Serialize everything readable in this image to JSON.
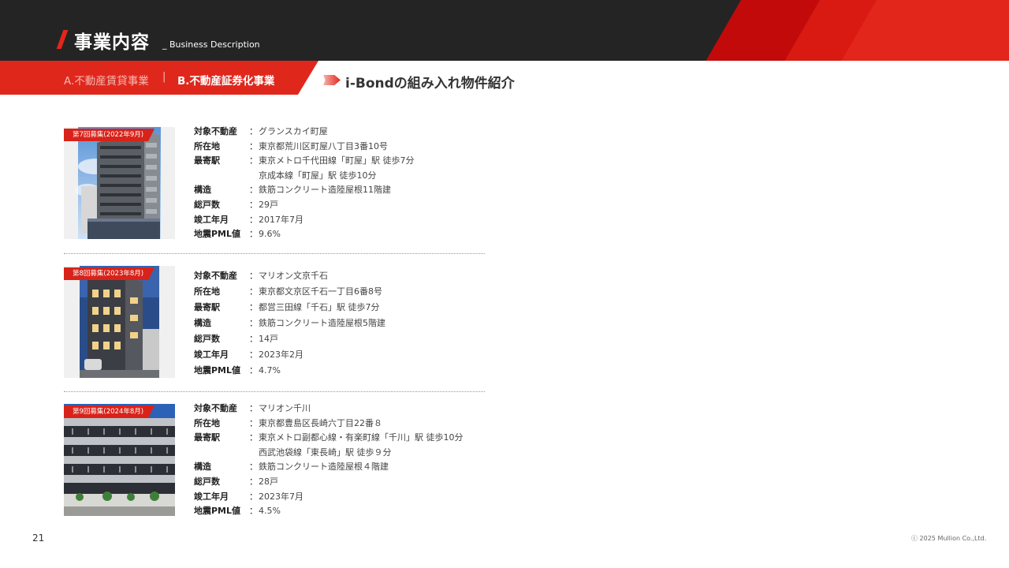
{
  "header": {
    "title": "事業内容",
    "subtitle": "_ Business Description"
  },
  "tabs": {
    "tab_a": "A.不動産賃貸事業",
    "separator": "|",
    "tab_b": "B.不動産証券化事業"
  },
  "section": {
    "title": "i-Bondの組み入れ物件紹介"
  },
  "colors": {
    "brand_red": "#e3261b",
    "header_dark": "#242424"
  },
  "properties": [
    {
      "badge": "第7回募集(2022年9月)",
      "rows": [
        {
          "label": "対象不動産",
          "value": "グランスカイ町屋"
        },
        {
          "label": "所在地",
          "value": "東京都荒川区町屋八丁目3番10号"
        },
        {
          "label": "最寄駅",
          "value": "東京メトロ千代田線「町屋」駅 徒歩7分"
        },
        {
          "label": "",
          "value": "京成本線「町屋」駅 徒歩10分"
        },
        {
          "label": "構造",
          "value": "鉄筋コンクリート造陸屋根11階建"
        },
        {
          "label": "総戸数",
          "value": "29戸"
        },
        {
          "label": "竣工年月",
          "value": "2017年7月"
        },
        {
          "label": "地震PML値",
          "value": "9.6%"
        }
      ]
    },
    {
      "badge": "第8回募集(2023年8月)",
      "rows": [
        {
          "label": "対象不動産",
          "value": "マリオン文京千石"
        },
        {
          "label": "所在地",
          "value": "東京都文京区千石一丁目6番8号"
        },
        {
          "label": "最寄駅",
          "value": "都営三田線「千石」駅 徒歩7分"
        },
        {
          "label": "構造",
          "value": "鉄筋コンクリート造陸屋根5階建"
        },
        {
          "label": "総戸数",
          "value": "14戸"
        },
        {
          "label": "竣工年月",
          "value": "2023年2月"
        },
        {
          "label": "地震PML値",
          "value": "4.7%"
        }
      ]
    },
    {
      "badge": "第9回募集(2024年8月)",
      "rows": [
        {
          "label": "対象不動産",
          "value": "マリオン千川"
        },
        {
          "label": "所在地",
          "value": "東京都豊島区長崎六丁目22番８"
        },
        {
          "label": "最寄駅",
          "value": "東京メトロ副都心線・有楽町線「千川」駅 徒歩10分"
        },
        {
          "label": "",
          "value": "西武池袋線「東長崎」駅 徒歩９分"
        },
        {
          "label": "構造",
          "value": "鉄筋コンクリート造陸屋根４階建"
        },
        {
          "label": "総戸数",
          "value": "28戸"
        },
        {
          "label": "竣工年月",
          "value": "2023年7月"
        },
        {
          "label": "地震PML値",
          "value": "4.5%"
        }
      ]
    }
  ],
  "footer": {
    "page_number": "21",
    "copyright": "ⓒ 2025 Mullion Co.,Ltd."
  }
}
